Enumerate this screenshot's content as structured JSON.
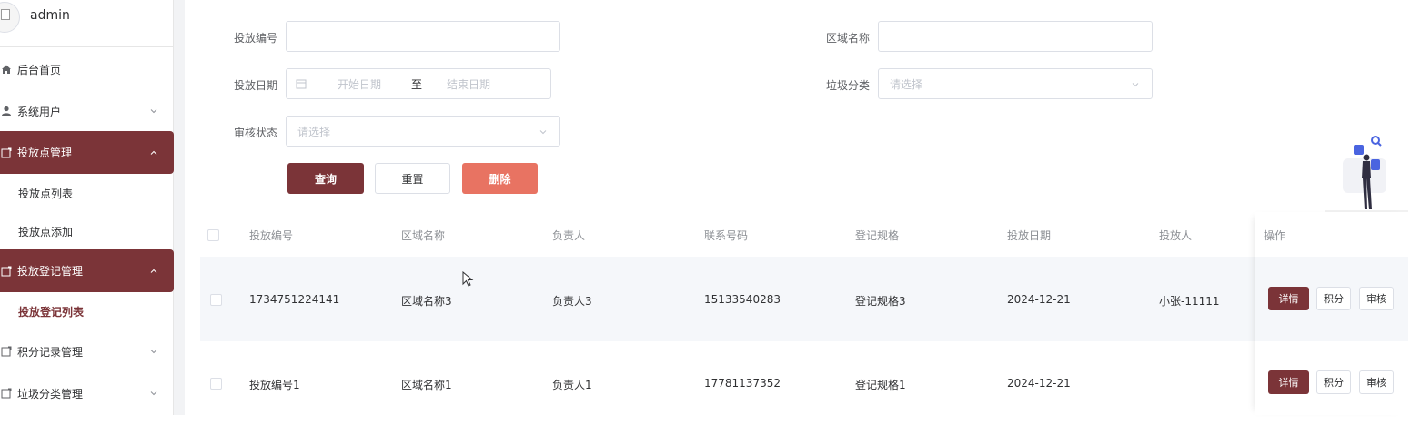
{
  "sidebar": {
    "username": "admin",
    "items": [
      {
        "label": "后台首页",
        "icon": "home-icon"
      },
      {
        "label": "系统用户",
        "icon": "user-icon"
      },
      {
        "label": "投放点管理",
        "icon": "folder-icon"
      },
      {
        "label": "投放点列表"
      },
      {
        "label": "投放点添加"
      },
      {
        "label": "投放登记管理",
        "icon": "folder-icon"
      },
      {
        "label": "投放登记列表"
      },
      {
        "label": "积分记录管理",
        "icon": "folder-icon"
      },
      {
        "label": "垃圾分类管理",
        "icon": "folder-icon"
      }
    ]
  },
  "search": {
    "code_label": "投放编号",
    "code_value": "",
    "area_label": "区域名称",
    "area_value": "",
    "date_label": "投放日期",
    "date_start_placeholder": "开始日期",
    "date_sep": "至",
    "date_end_placeholder": "结束日期",
    "category_label": "垃圾分类",
    "category_placeholder": "请选择",
    "status_label": "审核状态",
    "status_placeholder": "请选择",
    "query_button": "查询",
    "reset_button": "重置",
    "delete_button": "删除"
  },
  "table": {
    "headers": [
      "投放编号",
      "区域名称",
      "负责人",
      "联系号码",
      "登记规格",
      "投放日期",
      "投放人",
      "操作"
    ],
    "rows": [
      {
        "code": "1734751224141",
        "area": "区域名称3",
        "manager": "负责人3",
        "phone": "15133540283",
        "spec": "登记规格3",
        "date": "2024-12-21",
        "person": "小张-11111"
      },
      {
        "code": "投放编号1",
        "area": "区域名称1",
        "manager": "负责人1",
        "phone": "17781137352",
        "spec": "登记规格1",
        "date": "2024-12-21",
        "person": ""
      }
    ],
    "actions": {
      "detail": "详情",
      "points": "积分",
      "review": "审核"
    }
  },
  "colors": {
    "primary": "#7b3438",
    "danger": "#e87362"
  }
}
